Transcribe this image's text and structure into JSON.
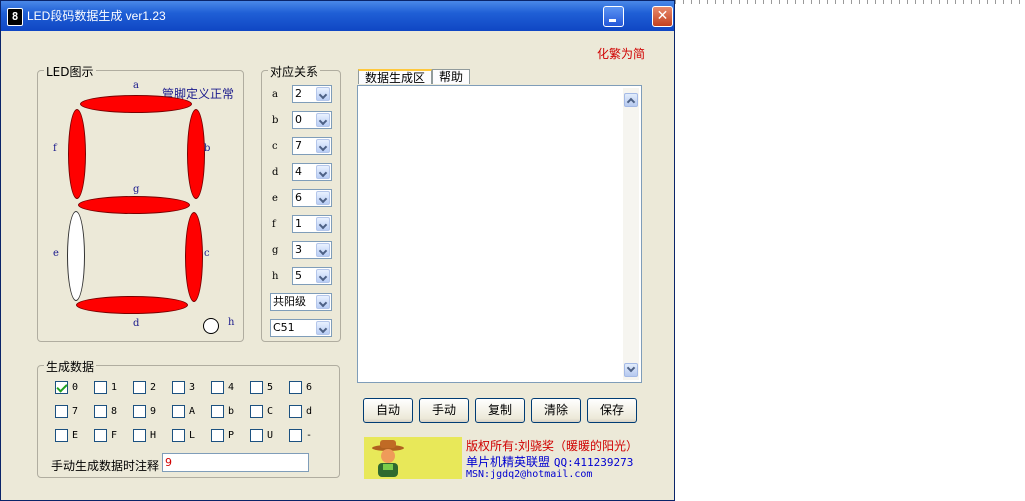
{
  "window": {
    "title": "LED段码数据生成 ver1.23",
    "icon_glyph": "8",
    "close_glyph": "✕"
  },
  "simplify_link": "化繁为简",
  "led_panel": {
    "title": "LED图示",
    "pin_status": "管脚定义正常",
    "segment_labels": {
      "a": "a",
      "b": "b",
      "c": "c",
      "d": "d",
      "e": "e",
      "f": "f",
      "g": "g",
      "h": "h"
    },
    "segment_state": {
      "a": "on",
      "b": "on",
      "c": "on",
      "d": "on",
      "e": "off",
      "f": "on",
      "g": "on",
      "h": "off"
    },
    "on_color": "#ff0000",
    "off_color": "#ffffff"
  },
  "mapping": {
    "title": "对应关系",
    "rows": [
      {
        "label": "a",
        "value": "2"
      },
      {
        "label": "b",
        "value": "0"
      },
      {
        "label": "c",
        "value": "7"
      },
      {
        "label": "d",
        "value": "4"
      },
      {
        "label": "e",
        "value": "6"
      },
      {
        "label": "f",
        "value": "1"
      },
      {
        "label": "g",
        "value": "3"
      },
      {
        "label": "h",
        "value": "5"
      }
    ],
    "polarity": "共阳级",
    "language": "C51"
  },
  "tabs": [
    {
      "label": "数据生成区",
      "active": true
    },
    {
      "label": "帮助",
      "active": false
    }
  ],
  "output_text": "",
  "buttons": {
    "auto": "自动",
    "manual": "手动",
    "copy": "复制",
    "clear": "清除",
    "save": "保存"
  },
  "generate": {
    "title": "生成数据",
    "checkboxes": [
      {
        "label": "0",
        "checked": true
      },
      {
        "label": "1",
        "checked": false
      },
      {
        "label": "2",
        "checked": false
      },
      {
        "label": "3",
        "checked": false
      },
      {
        "label": "4",
        "checked": false
      },
      {
        "label": "5",
        "checked": false
      },
      {
        "label": "6",
        "checked": false
      },
      {
        "label": "7",
        "checked": false
      },
      {
        "label": "8",
        "checked": false
      },
      {
        "label": "9",
        "checked": false
      },
      {
        "label": "A",
        "checked": false
      },
      {
        "label": "b",
        "checked": false
      },
      {
        "label": "C",
        "checked": false
      },
      {
        "label": "d",
        "checked": false
      },
      {
        "label": "E",
        "checked": false
      },
      {
        "label": "F",
        "checked": false
      },
      {
        "label": "H",
        "checked": false
      },
      {
        "label": "L",
        "checked": false
      },
      {
        "label": "P",
        "checked": false
      },
      {
        "label": "U",
        "checked": false
      },
      {
        "label": "-",
        "checked": false
      }
    ],
    "note_label": "手动生成数据时注释",
    "note_value": "9"
  },
  "copyright": {
    "line1": "版权所有:刘骁奖（暖暖的阳光）",
    "line2": "单片机精英联盟",
    "qq": "QQ:411239273",
    "msn": "MSN:jgdq2@hotmail.com"
  }
}
